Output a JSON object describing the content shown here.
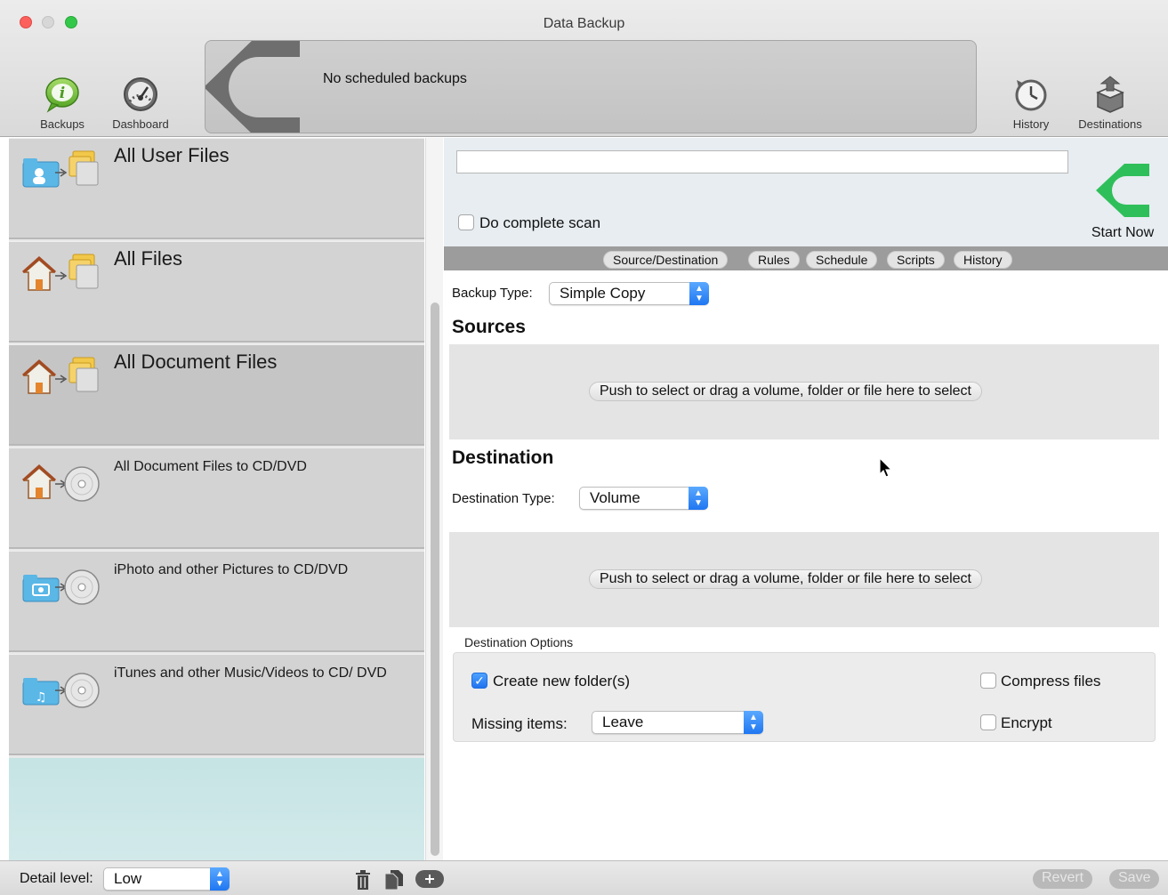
{
  "window": {
    "title": "Data Backup",
    "buttons": [
      "close",
      "minimize",
      "zoom"
    ]
  },
  "toolbar": {
    "backups_label": "Backups",
    "dashboard_label": "Dashboard",
    "history_label": "History",
    "destinations_label": "Destinations",
    "schedule_text": "No scheduled backups"
  },
  "sidebar": {
    "items": [
      {
        "label": "All User Files",
        "icon": "user-folder-icon"
      },
      {
        "label": "All Files",
        "icon": "home-folder-icon"
      },
      {
        "label": "All Document Files",
        "icon": "home-folder-icon"
      },
      {
        "label": "All Document Files to CD/DVD",
        "icon": "home-disc-icon"
      },
      {
        "label": "iPhoto and other Pictures to CD/DVD",
        "icon": "pictures-disc-icon"
      },
      {
        "label": "iTunes and other Music/Videos to CD/ DVD",
        "icon": "music-disc-icon"
      }
    ]
  },
  "bottom": {
    "detail_label": "Detail level:",
    "detail_value": "Low",
    "revert_label": "Revert",
    "save_label": "Save"
  },
  "editor": {
    "name_value": "",
    "complete_scan_label": "Do complete scan",
    "complete_scan_checked": false,
    "start_label": "Start Now",
    "tabs": [
      "Source/Destination",
      "Rules",
      "Schedule",
      "Scripts",
      "History"
    ],
    "backup_type_label": "Backup Type:",
    "backup_type_value": "Simple Copy",
    "sources_title": "Sources",
    "sources_button": "Push to select or drag a volume, folder or file here to select",
    "destination_title": "Destination",
    "destination_type_label": "Destination Type:",
    "destination_type_value": "Volume",
    "destination_button": "Push to select or drag a volume, folder or file here to select",
    "options_title": "Destination Options",
    "create_folder_label": "Create new folder(s)",
    "create_folder_checked": true,
    "compress_label": "Compress files",
    "compress_checked": false,
    "encrypt_label": "Encrypt",
    "encrypt_checked": false,
    "missing_items_label": "Missing items:",
    "missing_items_value": "Leave"
  },
  "colors": {
    "accent": "#1f76f1",
    "start_green": "#2fbf5a",
    "sidebar_item": "#d3d3d3",
    "tab_strip": "#9c9c9c"
  }
}
